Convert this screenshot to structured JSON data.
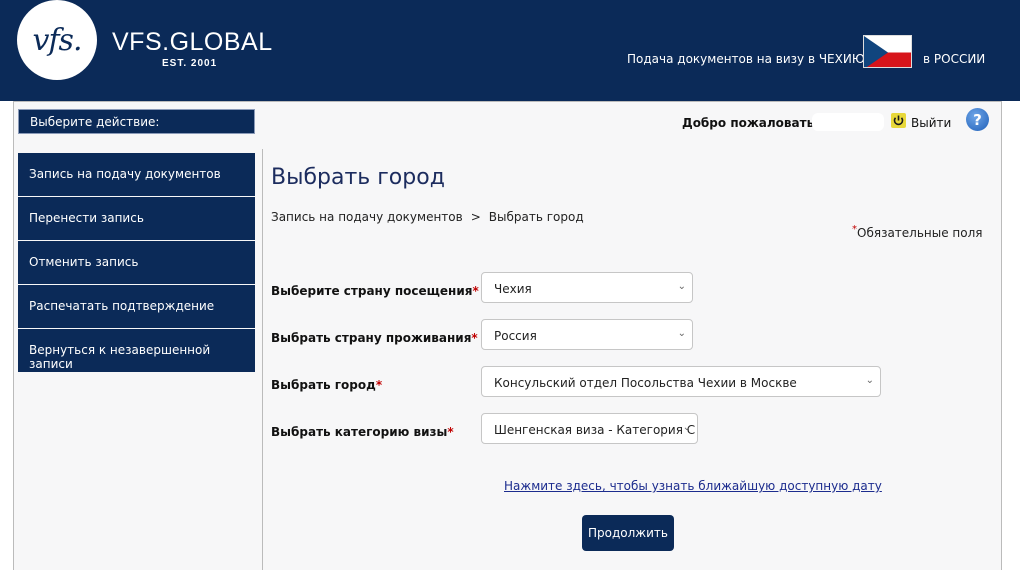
{
  "header": {
    "logo_text": "vfs.",
    "brand": "VFS.GLOBAL",
    "est": "EST. 2001",
    "submission_text": "Подача документов на визу в ЧЕХИЮ",
    "country_text": "в РОССИИ",
    "flag_icon": "czech-flag-icon"
  },
  "action_label": "Выберите действие:",
  "user_bar": {
    "welcome": "Добро пожаловать",
    "logout": "Выйти",
    "help": "?"
  },
  "sidebar": {
    "items": [
      {
        "label": "Запись на подачу документов"
      },
      {
        "label": "Перенести запись"
      },
      {
        "label": "Отменить запись"
      },
      {
        "label": "Распечатать подтверждение"
      },
      {
        "label": "Вернуться к незавершенной записи"
      }
    ]
  },
  "main": {
    "title": "Выбрать город",
    "breadcrumb": [
      "Запись на подачу документов",
      ">",
      "Выбрать город"
    ],
    "required_star": "*",
    "required_note": "Обязательные поля",
    "fields": [
      {
        "label": "Выберите страну посещения",
        "value": "Чехия"
      },
      {
        "label": "Выбрать страну проживания",
        "value": "Россия"
      },
      {
        "label": "Выбрать город",
        "value": "Консульский отдел Посольства Чехии в Москве"
      },
      {
        "label": "Выбрать категорию визы",
        "value": "Шенгенская виза - Категория С"
      }
    ],
    "earliest_date_link": "Нажмите здесь, чтобы узнать ближайшую доступную дату",
    "continue_button": "Продолжить"
  },
  "colors": {
    "navy": "#0b2a58",
    "required_red": "#c00000",
    "title": "#1c2c5e"
  }
}
